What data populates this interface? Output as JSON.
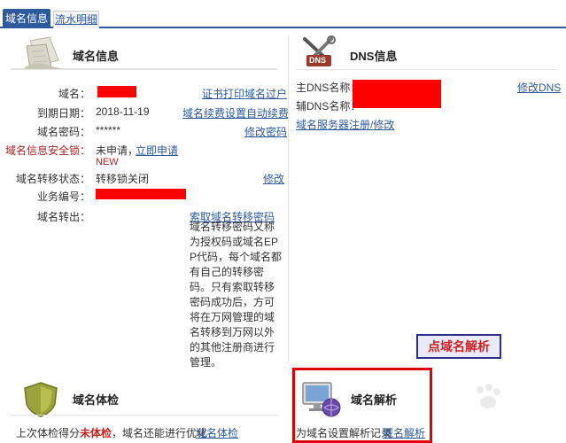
{
  "tabs": {
    "active": "域名信息",
    "other": "流水明细"
  },
  "domain_info": {
    "title": "域名信息",
    "rows": {
      "domain_label": "域名：",
      "expire_label": "到期日期：",
      "expire_value": "2018-11-19",
      "password_label": "域名密码：",
      "password_value": "******",
      "lock_label": "域名信息安全锁：",
      "lock_value": "未申请，",
      "lock_apply": "立即申请",
      "lock_new": "NEW",
      "transfer_lock_label": "域名转移状态：",
      "transfer_lock_value": "转移锁关闭",
      "business_label": "业务编号：",
      "transfer_out_label": "域名转出："
    },
    "links": {
      "print_cert": "证书打印",
      "transfer": "域名过户",
      "renew": "域名续费",
      "auto_renew": "设置自动续费",
      "change_password": "修改密码",
      "modify": "修改",
      "get_transfer_code": "索取域名转移密码"
    },
    "description": "域名转移密码又称为授权码或域名EPP代码，每个域名都有自己的转移密码。只有索取转移密码成功后，方可将在万网管理的域名转移到万网以外的其他注册商进行管理。"
  },
  "dns_info": {
    "title": "DNS信息",
    "icon_text": "DNS",
    "primary_label": "主DNS名称：",
    "secondary_label": "辅DNS名称：",
    "modify_link": "修改DNS",
    "register_link": "域名服务器注册/修改"
  },
  "health": {
    "title": "域名体检",
    "line_prefix": "上次体检得分",
    "score": "未体检",
    "line_suffix": "，域名还能进行优化",
    "link": "域名体检"
  },
  "resolve": {
    "title": "域名解析",
    "line": "为域名设置解析记录",
    "link": "域名解析",
    "callout": "点域名解析"
  },
  "colors": {
    "tab_blue": "#2d5a9e",
    "link_blue": "#2d5a9e",
    "redacted": "#ff0000",
    "highlight_red": "#e00000"
  }
}
